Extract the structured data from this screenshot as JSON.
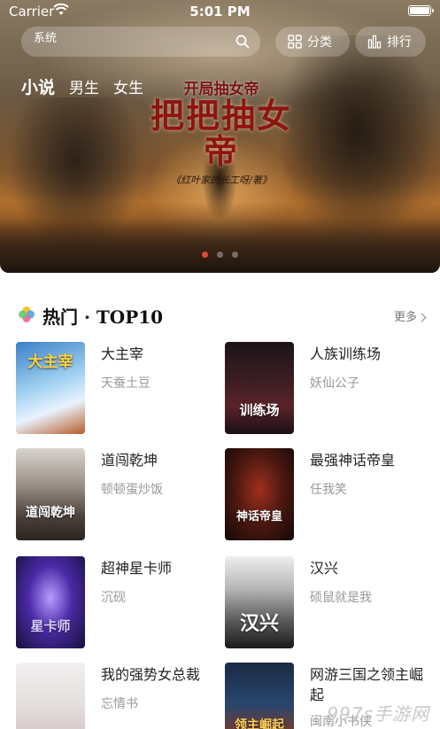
{
  "status_bar": {
    "carrier": "Carrier",
    "time": "5:01 PM"
  },
  "search": {
    "placeholder": "系统"
  },
  "actions": {
    "category": "分类",
    "ranking": "排行"
  },
  "tabs": [
    {
      "label": "小说",
      "active": true
    },
    {
      "label": "男生",
      "active": false
    },
    {
      "label": "女生",
      "active": false
    }
  ],
  "banner": {
    "top_text": "开局抽女帝",
    "main_text": "把把抽女帝",
    "author_text": "《红叶家的长工呀/著》",
    "slide_count": 3,
    "active_slide": 1
  },
  "section": {
    "title": "热门 · TOP10",
    "more": "更多"
  },
  "books": [
    {
      "title": "大主宰",
      "author": "天蚕土豆",
      "cover_text": "大主宰"
    },
    {
      "title": "人族训练场",
      "author": "妖仙公子",
      "cover_text": "训练场"
    },
    {
      "title": "道闯乾坤",
      "author": "顿顿蛋炒饭",
      "cover_text": "道闯乾坤"
    },
    {
      "title": "最强神话帝皇",
      "author": "任我笑",
      "cover_text": "神话帝皇"
    },
    {
      "title": "超神星卡师",
      "author": "沉砚",
      "cover_text": "星卡师"
    },
    {
      "title": "汉兴",
      "author": "硕鼠就是我",
      "cover_text": "汉兴"
    },
    {
      "title": "我的强势女总裁",
      "author": "忘情书",
      "cover_text": ""
    },
    {
      "title": "网游三国之领主崛起",
      "author": "闽南小书侠",
      "cover_text": "领主崛起"
    }
  ],
  "watermark": "997s手游网",
  "colors": {
    "accent": "#e24a3a",
    "muted_text": "#999999",
    "title_text": "#222222"
  }
}
